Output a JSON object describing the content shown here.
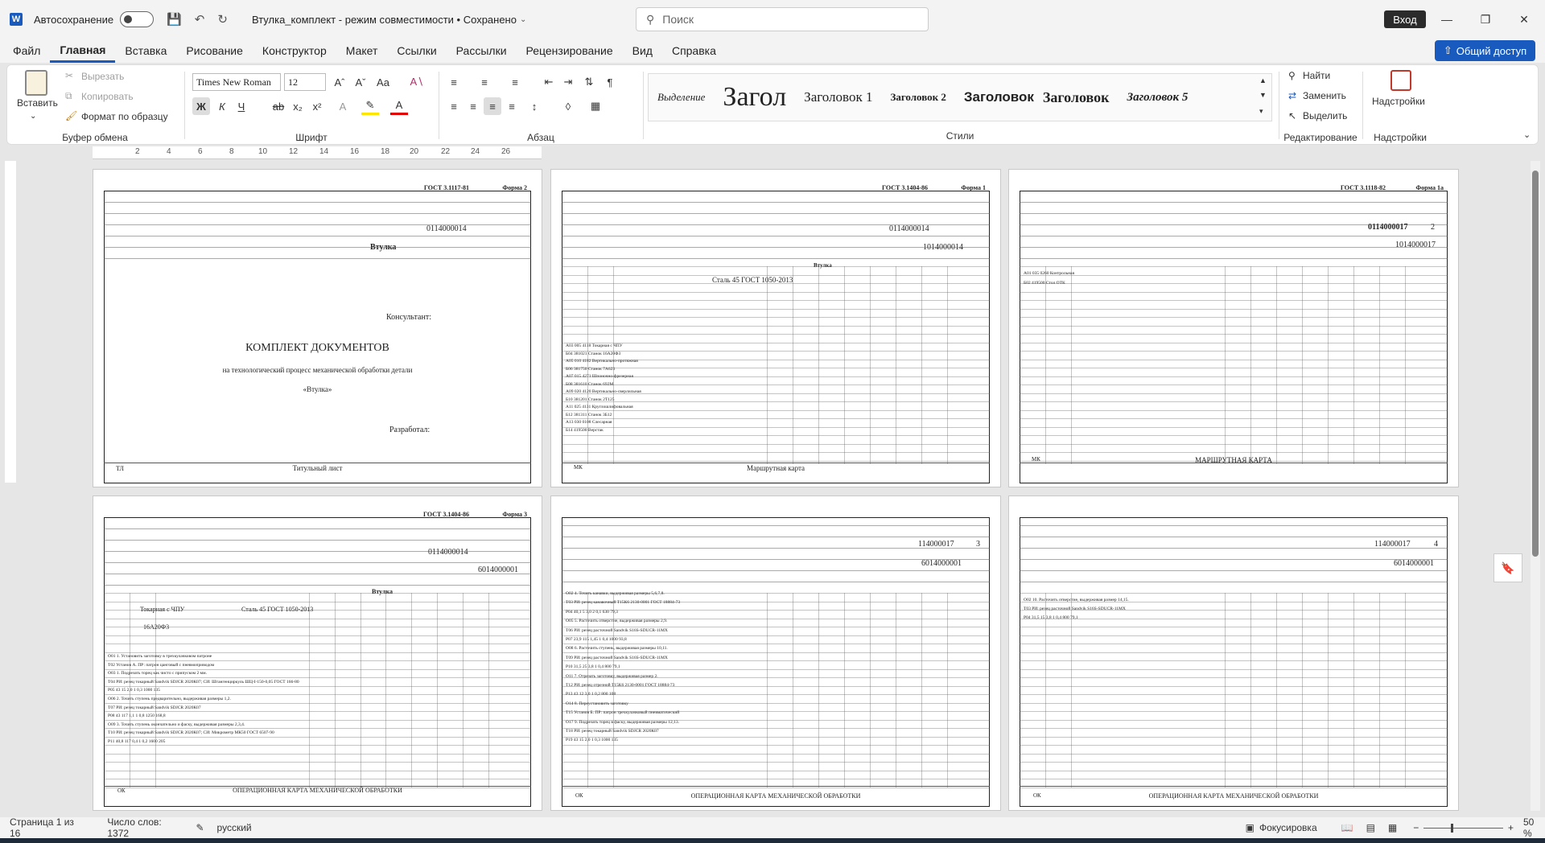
{
  "titlebar": {
    "autosave": "Автосохранение",
    "doc_title": "Втулка_комплект  -  режим совместимости • Сохранено",
    "search_placeholder": "Поиск",
    "signin": "Вход"
  },
  "tabs": [
    "Файл",
    "Главная",
    "Вставка",
    "Рисование",
    "Конструктор",
    "Макет",
    "Ссылки",
    "Рассылки",
    "Рецензирование",
    "Вид",
    "Справка"
  ],
  "share": "Общий доступ",
  "ribbon": {
    "clipboard": {
      "paste": "Вставить",
      "cut": "Вырезать",
      "copy": "Копировать",
      "format": "Формат по образцу",
      "label": "Буфер обмена"
    },
    "font": {
      "name": "Times New Roman",
      "size": "12",
      "label": "Шрифт"
    },
    "paragraph": {
      "label": "Абзац"
    },
    "styles": {
      "items": [
        "Выделение",
        "Загол",
        "Заголовок 1",
        "Заголовок 2",
        "Заголовок 3",
        "Заголовок",
        "Заголовок 5"
      ],
      "label": "Стили"
    },
    "editing": {
      "find": "Найти",
      "replace": "Заменить",
      "select": "Выделить",
      "label": "Редактирование"
    },
    "addins": {
      "button": "Надстройки",
      "label": "Надстройки"
    }
  },
  "ruler": [
    "2",
    "4",
    "6",
    "8",
    "10",
    "12",
    "14",
    "16",
    "18",
    "20",
    "22",
    "24",
    "26"
  ],
  "pages": [
    {
      "gost": "ГОСТ 3.1117-81",
      "form": "Форма 2",
      "code": "0114000014",
      "name": "Втулка",
      "consultant": "Консультант:",
      "title": "КОМПЛЕКТ ДОКУМЕНТОВ",
      "subtitle": "на технологический процесс механической обработки детали",
      "part": "«Втулка»",
      "developed": "Разработал:",
      "footer_left": "ТЛ",
      "footer": "Титульный лист"
    },
    {
      "gost": "ГОСТ 3.1404-86",
      "form": "Форма 1",
      "code": "0114000014",
      "code2": "1014000014",
      "name": "Втулка",
      "material": "Сталь 45 ГОСТ 1050-2013",
      "footer_left": "МК",
      "footer": "Маршрутная карта",
      "rows": [
        "А03   005   4118   Токарная с ЧПУ",
        "Б04   381021   Станок 16А20Ф3",
        "А05   010   4182   Вертикально-протяжная",
        "Б06   381750   Станок 7А623",
        "А07   015   4271   Шпоночно-фрезерная",
        "Б08   381610   Станок 692М",
        "А09   020   4120   Вертикально-сверлильная",
        "Б10   381201   Станок 2Т125",
        "А11   025   4131   Круглошлифовальная",
        "Б12   381311   Станок 3Б12",
        "А13   030   0108   Слесарная",
        "Б14   419500   Верстак"
      ]
    },
    {
      "gost": "ГОСТ 3.1118-82",
      "form": "Форма 1а",
      "code": "0114000017",
      "code2": "1014000017",
      "sheet": "2",
      "footer_left": "МК",
      "footer": "МАРШРУТНАЯ КАРТА",
      "rows": [
        "А01   035   0260   Контрольная",
        "Б02   419500   Стол ОТК"
      ]
    },
    {
      "gost": "ГОСТ 3.1404-86",
      "form": "Форма 3",
      "code": "0114000014",
      "code2": "6014000001",
      "name": "Втулка",
      "op": "Токарная с ЧПУ",
      "material": "Сталь 45 ГОСТ 1050-2013",
      "machine": "16А20Ф3",
      "footer_left": "ОК",
      "footer": "ОПЕРАЦИОННАЯ КАРТА МЕХАНИЧЕСКОЙ ОБРАБОТКИ",
      "rows": [
        "О01   1. Установить заготовку в трехкулачковом патроне",
        "Т02   Установ А. ПР: патрон цанговый с пневмоприводом",
        "О03   1. Подрезать торец как чисто с припуском 2 мм.",
        "Т04   РИ: резец токарный Sandvik SDJCR 2020К07; СИ: Штангенциркуль ШЦ-I-150-0,05 ГОСТ 166-80",
        "Р05   43   15   2,0   1   0,3   1000   135",
        "О06   2. Точить ступень предварительно, выдерживая размеры 1,2.",
        "Т07   РИ: резец токарный Sandvik SDJCR 2020К07",
        "Р08   43   117   1,1   1   0,8   1250   168,8",
        "О09   3. Точить ступень окончательно и фаску, выдерживая размеры 2,3,4.",
        "Т10   РИ: резец токарный Sandvik SDJCR 2020К07; СИ: Микрометр МК50 ГОСТ 6507-90",
        "Р11   40,8   117   0,4   1   0,2   1600   205"
      ]
    },
    {
      "code": "114000017",
      "code2": "6014000001",
      "sheet": "3",
      "footer_left": "ОК",
      "footer": "ОПЕРАЦИОННАЯ КАРТА МЕХАНИЧЕСКОЙ ОБРАБОТКИ",
      "rows": [
        "О02   4. Точить канавки, выдерживая размеры 5,6,7,8.",
        "Т03   РИ: резец канавочный Т15К6 2130-0001 ГОСТ 18884-73",
        "Р04   40,1   5   3,0   2   0,1   630   79,3",
        "О05   5. Расточить отверстие, выдерживая размеры 2,9.",
        "Т06   РИ: резец расточной Sandvik S16S-SDUCR-11MX",
        "Р07   23,9   115   1,45   1   0,4   1000   93,8",
        "О08   6. Расточить ступень, выдерживая размеры 10,11.",
        "Т09   РИ: резец расточной Sandvik S16S-SDUCR-11MX",
        "Р10   31,5   25   3,8   1   0,4   800   79,1",
        "О11   7. Отрезать заготовку, выдерживая размер 2.",
        "Т12   РИ: резец отрезной Т15К6 2130-0001 ГОСТ 18884-73",
        "Р13   43   12   3,0   1   0,2   800   108",
        "О14   8. Переустановить заготовку",
        "Т15   Установ Б. ПР: патрон трехкулачковый пневматический",
        "О17   9. Подрезать торец в фаску, выдерживая размеры 12,13.",
        "Т18   РИ: резец токарный Sandvik SDJCR 2020К07",
        "Р19   43   15   2,0   1   0,3   1000   135"
      ]
    },
    {
      "code": "114000017",
      "code2": "6014000001",
      "sheet": "4",
      "footer_left": "ОК",
      "footer": "ОПЕРАЦИОННАЯ КАРТА МЕХАНИЧЕСКОЙ ОБРАБОТКИ",
      "rows": [
        "О02   10. Расточить отверстие, выдерживая размер 14,15.",
        "Т03   РИ: резец расточной Sandvik S16S-SDUCR-11MX",
        "Р04   31,5   15   3,8   1   0,4   800   79,1"
      ]
    }
  ],
  "status": {
    "page": "Страница 1 из 16",
    "words": "Число слов: 1372",
    "lang": "русский",
    "focus": "Фокусировка",
    "zoom": "50 %"
  }
}
